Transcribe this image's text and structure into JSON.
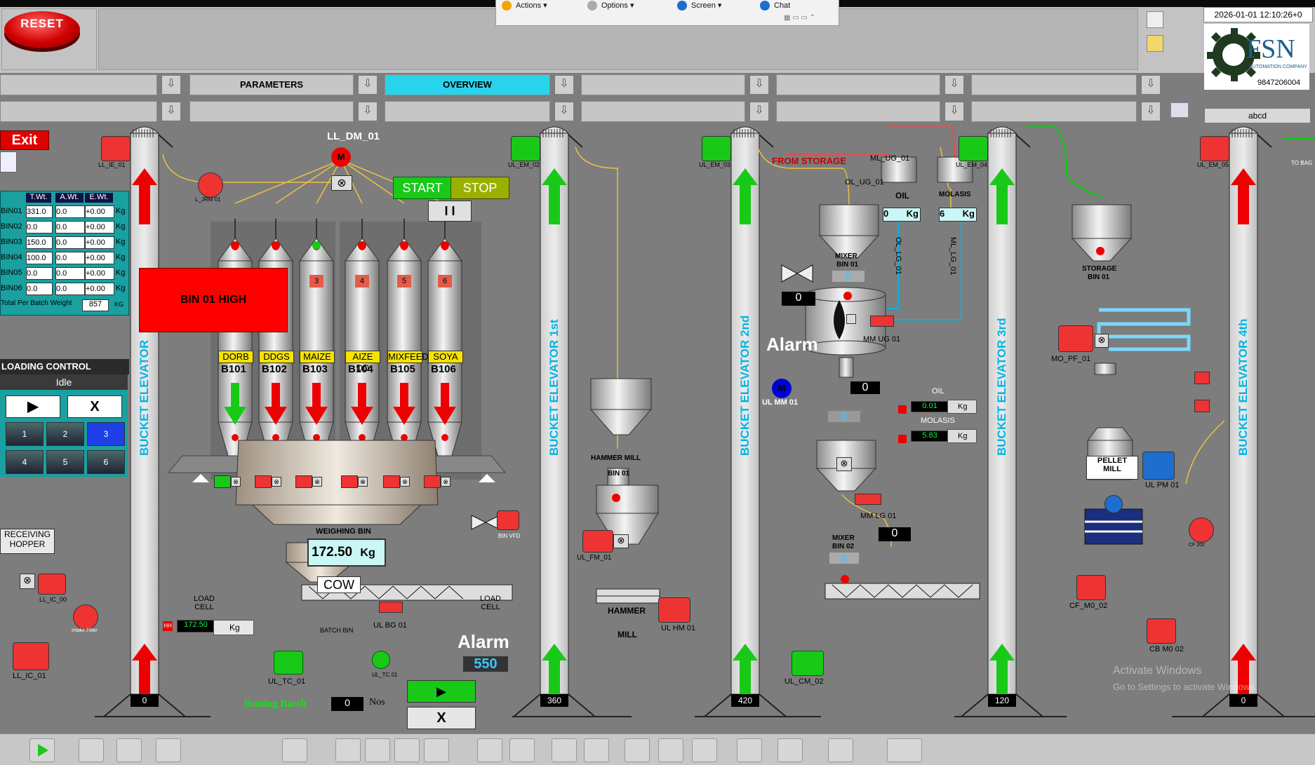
{
  "header": {
    "reset_label": "RESET",
    "datetime": "2026-01-01 12:10:26+0",
    "company_phone": "9847206004",
    "logo_text": "FSN",
    "logo_sub": "AUTOMATION COMPANY",
    "user_field": "abcd"
  },
  "remote_menu": [
    "Actions",
    "Options",
    "Screen",
    "Chat"
  ],
  "nav": {
    "tab_parameters": "PARAMETERS",
    "tab_overview": "OVERVIEW"
  },
  "exit_label": "Exit",
  "bin_table": {
    "headers": [
      "T.Wt.",
      "A.Wt.",
      "E.Wt."
    ],
    "rows": [
      {
        "bin": "BIN01",
        "t": "331.0",
        "a": "0.0",
        "e": "+0.00",
        "u": "Kg"
      },
      {
        "bin": "BIN02",
        "t": "0.0",
        "a": "0.0",
        "e": "+0.00",
        "u": "Kg"
      },
      {
        "bin": "BIN03",
        "t": "150.0",
        "a": "0.0",
        "e": "+0.00",
        "u": "Kg"
      },
      {
        "bin": "BIN04",
        "t": "100.0",
        "a": "0.0",
        "e": "+0.00",
        "u": "Kg"
      },
      {
        "bin": "BIN05",
        "t": "0.0",
        "a": "0.0",
        "e": "+0.00",
        "u": "Kg"
      },
      {
        "bin": "BIN06",
        "t": "0.0",
        "a": "0.0",
        "e": "+0.00",
        "u": "Kg"
      }
    ],
    "total_label": "Total Per Batch Weight",
    "total_value": "857",
    "total_unit": "KG"
  },
  "loading": {
    "title": "LOADING CONTROL",
    "status": "Idle",
    "play": "▶",
    "stop": "X",
    "buttons": [
      "1",
      "2",
      "3",
      "4",
      "5",
      "6"
    ],
    "selected": "3"
  },
  "alert_banner": "BIN 01 HIGH",
  "dm": {
    "label": "LL_DM_01",
    "motor": "M",
    "start": "START",
    "stop": "STOP",
    "pause": "I I"
  },
  "bins": [
    {
      "num": "",
      "ingredient": "DORB",
      "id": "B101"
    },
    {
      "num": "",
      "ingredient": "DDGS",
      "id": "B102"
    },
    {
      "num": "3",
      "ingredient": "MAIZE",
      "id": "B103"
    },
    {
      "num": "4",
      "ingredient": "AIZE DD",
      "id": "B104"
    },
    {
      "num": "5",
      "ingredient": "MIXFEED",
      "id": "B105"
    },
    {
      "num": "6",
      "ingredient": "SOYA",
      "id": "B106"
    }
  ],
  "weighing": {
    "title": "WEIGHING BIN",
    "value": "172.50",
    "unit": "Kg",
    "cow": "COW",
    "load_cell": "LOAD CELL",
    "hh": "HH",
    "hh_value": "172.50",
    "hh_unit": "Kg",
    "batch_bin": "BATCH BIN",
    "ul_bg": "UL BG 01",
    "bin_vfd": "BIN VFD"
  },
  "batch": {
    "label": "Runing Batch",
    "value": "0",
    "unit": "Nos",
    "play": "▶",
    "stop": "X"
  },
  "conveyor": {
    "alarm": "Alarm",
    "value": "550",
    "ul_tc": "UL_TC_01",
    "ul_tc2": "UL_TC 01"
  },
  "receiving": {
    "label": "RECEIVING HOPPER",
    "ll_ic_00": "LL_IC_00",
    "ll_ic_01": "LL_IC_01",
    "intake": "Intake Filter"
  },
  "elevators": [
    {
      "name": "BUCKET ELEVATOR",
      "motor": "LL_IE_01",
      "count": "0",
      "dir": "up-red"
    },
    {
      "name": "BUCKET ELEVATOR 1st",
      "motor": "UL_EM_02",
      "count": "360",
      "dir": "up-green"
    },
    {
      "name": "BUCKET ELEVATOR 2nd",
      "motor": "UL_EM_03",
      "count": "420",
      "dir": "up-green"
    },
    {
      "name": "BUCKET ELEVATOR 3rd",
      "motor": "UL_EM_04",
      "count": "120",
      "dir": "up-green"
    },
    {
      "name": "BUCKET ELEVATOR 4th",
      "motor": "UL_EM_05",
      "count": "0",
      "dir": "up-red"
    }
  ],
  "jrm": "L_JRM 01",
  "hammer": {
    "bin": "HAMMER MILL",
    "bin_id": "BIN 01",
    "mill": "HAMMER",
    "mill2": "MILL",
    "fm": "UL_FM_01",
    "hm": "UL HM 01"
  },
  "mixer": {
    "from_storage": "FROM STORAGE",
    "ml_ug": "ML_UG_01",
    "ol_ug": "OL_UG_01",
    "oil_label": "OIL",
    "oil_value": "0",
    "oil_unit": "Kg",
    "mol_label": "MOLASIS",
    "mol_value": "6",
    "mol_unit": "Kg",
    "ol_lg": "OL_LG_01",
    "ml_lg": "ML_LG_01",
    "bin1": "MIXER",
    "bin1b": "BIN 01",
    "bin1_value": "0",
    "side_value": "0",
    "alarm": "Alarm",
    "mm_ug": "MM UG 01",
    "ul_mm": "UL MM 01",
    "motor": "M",
    "mix_value": "0",
    "mix_value2": "0",
    "oil_flow_label": "OIL",
    "oil_flow": "0.01",
    "oil_flow_unit": "Kg",
    "mol_flow_label": "MOLASIS",
    "mol_flow": "5.83",
    "mol_flow_unit": "Kg",
    "mm_lg": "MM LG 01",
    "bin2": "MIXER",
    "bin2b": "BIN 02",
    "bin2_value": "0",
    "bin2_side": "0",
    "ul_cm": "UL_CM_02"
  },
  "pellet": {
    "storage": "STORAGE",
    "storage_bin": "BIN 01",
    "mo_pf": "MO_PF_01",
    "pm": "PELLET",
    "pm2": "MILL",
    "ul_pm": "UL PM 01",
    "cf": "CF_M0_02",
    "cfb": "CF 202",
    "cb": "CB M0 02",
    "to_bag": "TO BAG"
  },
  "watermark": {
    "line1": "Activate Windows",
    "line2": "Go to Settings to activate Windows."
  }
}
